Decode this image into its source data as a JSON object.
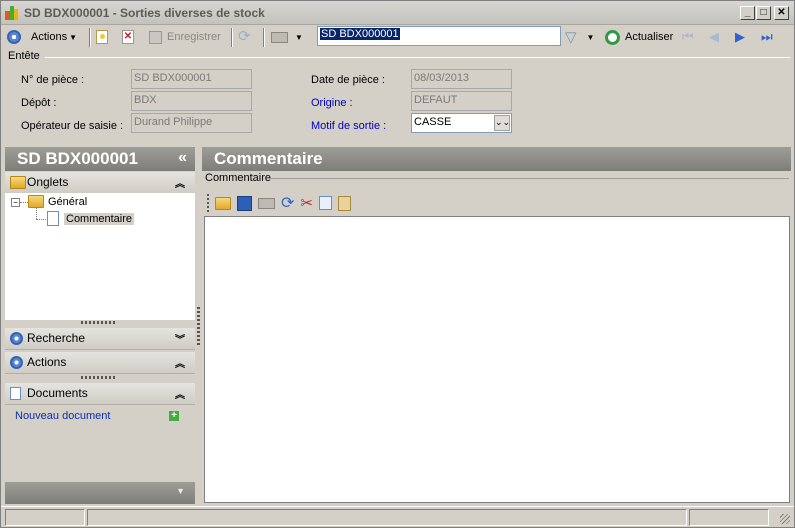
{
  "window": {
    "title": "SD BDX000001 - Sorties diverses de stock",
    "minimize": "_",
    "maximize": "□",
    "close": "✕"
  },
  "toolbar": {
    "actions_label": "Actions",
    "save_label": "Enregistrer",
    "doc_number": "SD BDX000001",
    "refresh_label": "Actualiser"
  },
  "entete": {
    "section_label": "Entête",
    "fields": {
      "num_piece_label": "N° de pièce :",
      "num_piece_value": "SD BDX000001",
      "depot_label": "Dépôt :",
      "depot_value": "BDX",
      "operateur_label": "Opérateur de saisie :",
      "operateur_value": "Durand Philippe",
      "date_piece_label": "Date de pièce :",
      "date_piece_value": "08/03/2013",
      "origine_label": "Origine :",
      "origine_value": "DEFAUT",
      "motif_label": "Motif de sortie :",
      "motif_value": "CASSE"
    }
  },
  "left_panel": {
    "header": "SD BDX000001",
    "collapse": "«",
    "onglets_label": "Onglets",
    "tree": {
      "root": "Général",
      "child": "Commentaire"
    },
    "recherche_label": "Recherche",
    "actions_label": "Actions",
    "documents_label": "Documents",
    "new_document_label": "Nouveau document"
  },
  "right_panel": {
    "header": "Commentaire",
    "group_label": "Commentaire"
  }
}
